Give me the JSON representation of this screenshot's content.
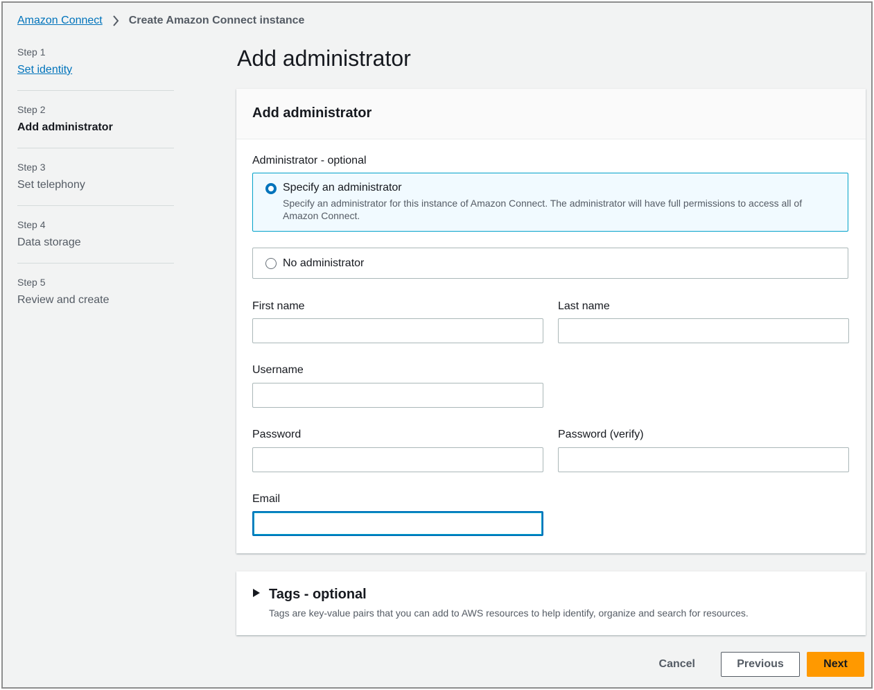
{
  "breadcrumb": {
    "parent": "Amazon Connect",
    "current": "Create Amazon Connect instance"
  },
  "steps": [
    {
      "number": "Step 1",
      "label": "Set identity",
      "state": "link"
    },
    {
      "number": "Step 2",
      "label": "Add administrator",
      "state": "active"
    },
    {
      "number": "Step 3",
      "label": "Set telephony",
      "state": "disabled"
    },
    {
      "number": "Step 4",
      "label": "Data storage",
      "state": "disabled"
    },
    {
      "number": "Step 5",
      "label": "Review and create",
      "state": "disabled"
    }
  ],
  "page_title": "Add administrator",
  "panel": {
    "title": "Add administrator",
    "admin_group_label": "Administrator - optional",
    "options": [
      {
        "title": "Specify an administrator",
        "description": "Specify an administrator for this instance of Amazon Connect. The administrator will have full permissions to access all of Amazon Connect.",
        "selected": true
      },
      {
        "title": "No administrator",
        "selected": false
      }
    ],
    "fields": {
      "first_name": {
        "label": "First name",
        "value": ""
      },
      "last_name": {
        "label": "Last name",
        "value": ""
      },
      "username": {
        "label": "Username",
        "value": ""
      },
      "password": {
        "label": "Password",
        "value": ""
      },
      "password_verify": {
        "label": "Password (verify)",
        "value": ""
      },
      "email": {
        "label": "Email",
        "value": ""
      }
    }
  },
  "tags": {
    "title": "Tags - optional",
    "description": "Tags are key-value pairs that you can add to AWS resources to help identify, organize and search for resources.",
    "expanded": false
  },
  "actions": {
    "cancel": "Cancel",
    "previous": "Previous",
    "next": "Next"
  },
  "colors": {
    "link": "#0073bb",
    "primary_button": "#ff9900",
    "selected_card_border": "#00a1c9",
    "selected_card_bg": "#f1faff"
  },
  "icons": {
    "breadcrumb_separator": "chevron-right-icon",
    "tags_toggle": "caret-right-icon"
  }
}
